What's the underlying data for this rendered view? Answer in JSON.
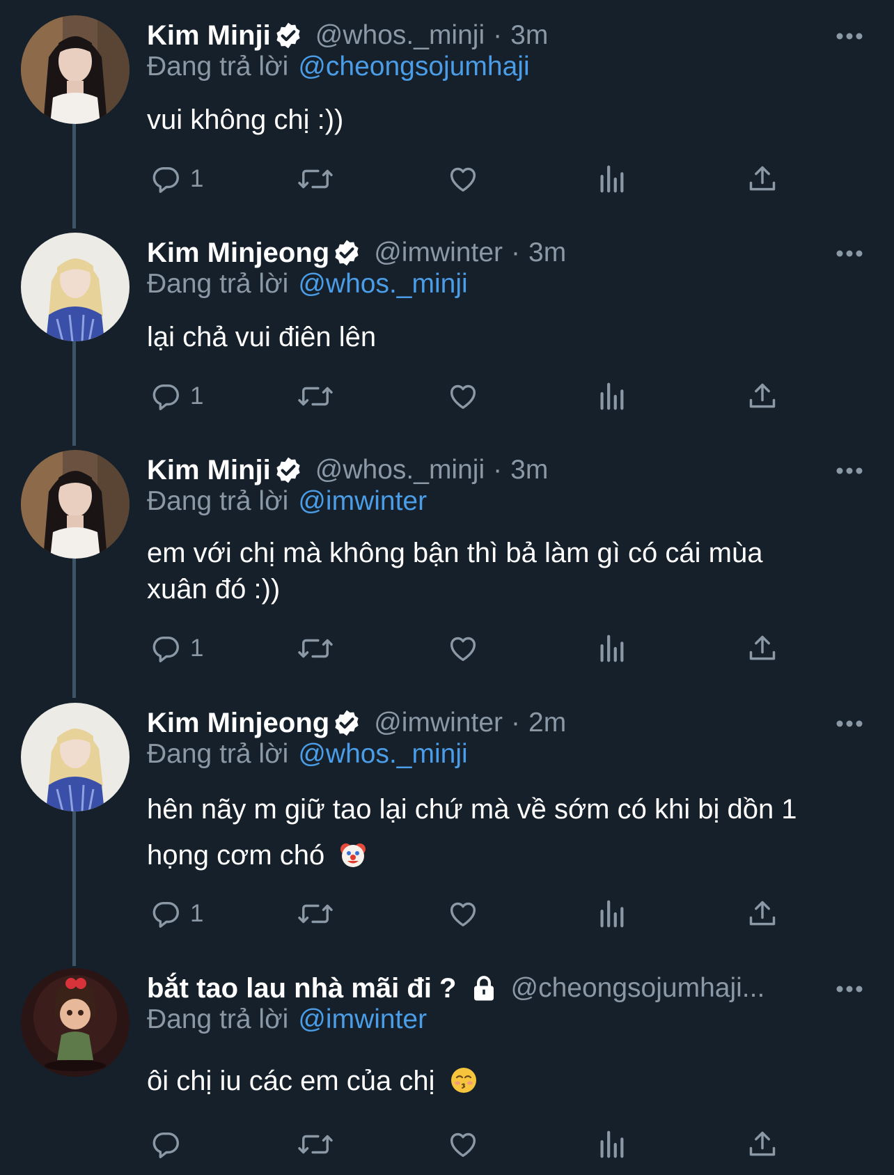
{
  "colors": {
    "background": "#15202b",
    "secondary_text": "#8b98a5",
    "link": "#4a9de6",
    "thread_line": "#3d5466",
    "verified_badge": "#ffffff"
  },
  "reply_prefix": "Đang trả lời",
  "tweets": [
    {
      "name": "Kim Minji",
      "verified": true,
      "handle": "@whos._minji",
      "separator": "·",
      "time": "3m",
      "reply_to": "@cheongsojumhaji",
      "text": "vui không chị :))",
      "reply_count": "1",
      "avatar_icon": "avatar-dark-hair-photo"
    },
    {
      "name": "Kim Minjeong",
      "verified": true,
      "handle": "@imwinter",
      "separator": "·",
      "time": "3m",
      "reply_to": "@whos._minji",
      "text": "lại chả vui điên lên",
      "reply_count": "1",
      "avatar_icon": "avatar-blonde-hair-photo"
    },
    {
      "name": "Kim Minji",
      "verified": true,
      "handle": "@whos._minji",
      "separator": "·",
      "time": "3m",
      "reply_to": "@imwinter",
      "text_line1": "em với chị mà không bận thì bả làm gì có cái mùa",
      "text_line2": "xuân đó :))",
      "reply_count": "1",
      "avatar_icon": "avatar-dark-hair-photo"
    },
    {
      "name": "Kim Minjeong",
      "verified": true,
      "handle": "@imwinter",
      "separator": "·",
      "time": "2m",
      "reply_to": "@whos._minji",
      "text_line1": "hên nãy m giữ tao lại chứ mà về sớm có khi bị dồn 1",
      "text_line2": "họng cơm chó",
      "emoji_icon": "clown-face-icon",
      "reply_count": "1",
      "avatar_icon": "avatar-blonde-hair-photo"
    },
    {
      "name": "bắt tao lau nhà mãi đi ?",
      "locked": true,
      "handle": "@cheongsojumhaji...",
      "reply_to": "@imwinter",
      "text": "ôi chị iu các em của chị",
      "emoji_icon": "kissing-face-icon",
      "reply_count": "",
      "avatar_icon": "avatar-cartoon-girl"
    }
  ]
}
